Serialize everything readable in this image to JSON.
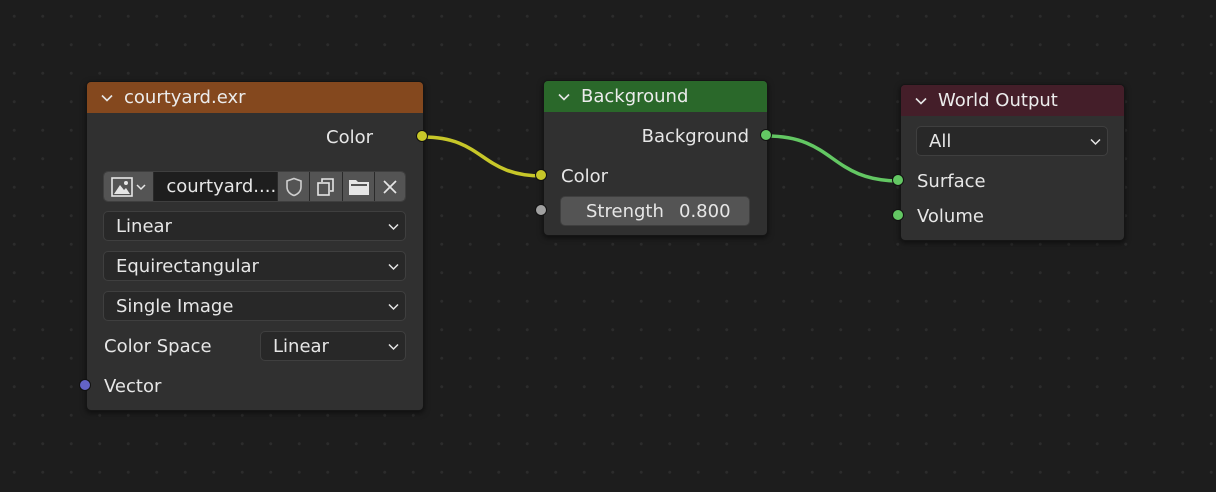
{
  "colors": {
    "image_header": "#84481e",
    "background_header": "#2a682a",
    "output_header": "#441e29",
    "socket_color": "#c7c729",
    "socket_vector": "#6363c7",
    "socket_shader": "#63c763",
    "socket_float": "#a1a1a1",
    "link_color": "#c7c729",
    "link_shader": "#63c763"
  },
  "image_node": {
    "title": "courtyard.exr",
    "output_color_label": "Color",
    "image_name": "courtyard....",
    "interpolation": "Linear",
    "projection": "Equirectangular",
    "source": "Single Image",
    "color_space_label": "Color Space",
    "color_space_value": "Linear",
    "input_vector_label": "Vector"
  },
  "background_node": {
    "title": "Background",
    "output_label": "Background",
    "input_color_label": "Color",
    "strength_label": "Strength",
    "strength_value": "0.800"
  },
  "output_node": {
    "title": "World Output",
    "target": "All",
    "input_surface_label": "Surface",
    "input_volume_label": "Volume"
  },
  "icons": [
    "chevron-down-icon",
    "image-icon",
    "shield-icon",
    "duplicate-icon",
    "folder-icon",
    "close-icon"
  ]
}
